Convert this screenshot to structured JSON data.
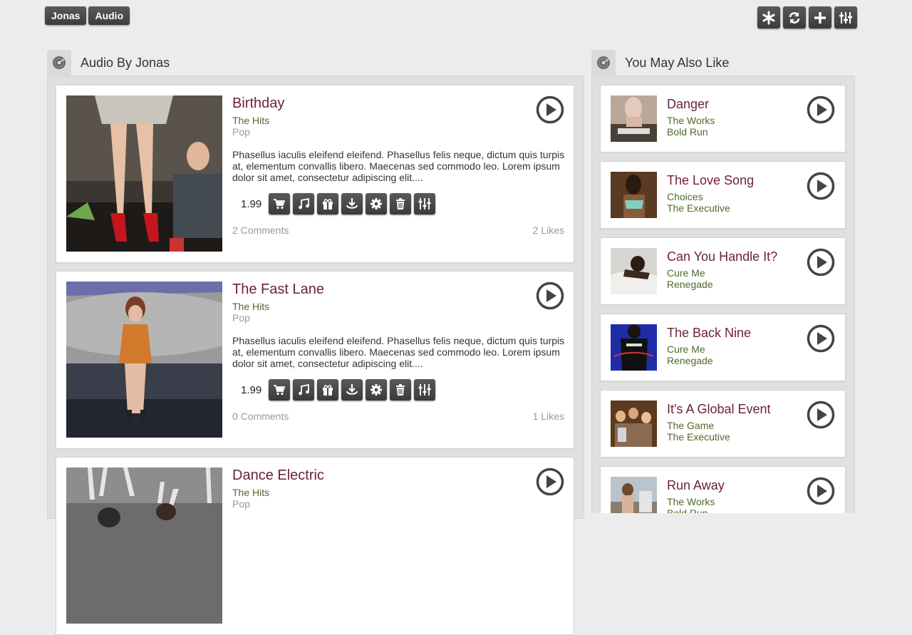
{
  "breadcrumbs": [
    "Jonas",
    "Audio"
  ],
  "toolbar_icons": [
    "asterisk-icon",
    "refresh-icon",
    "plus-icon",
    "sliders-icon"
  ],
  "main_panel": {
    "title": "Audio By Jonas",
    "tracks": [
      {
        "title": "Birthday",
        "album": "The Hits",
        "genre": "Pop",
        "description": "Phasellus iaculis eleifend eleifend. Phasellus felis neque, dictum quis turpis at, elementum convallis libero. Maecenas sed commodo leo. Lorem ipsum dolor sit amet, consectetur adipiscing elit....",
        "price": "1.99",
        "comments": "2 Comments",
        "likes": "2 Likes"
      },
      {
        "title": "The Fast Lane",
        "album": "The Hits",
        "genre": "Pop",
        "description": "Phasellus iaculis eleifend eleifend. Phasellus felis neque, dictum quis turpis at, elementum convallis libero. Maecenas sed commodo leo. Lorem ipsum dolor sit amet, consectetur adipiscing elit....",
        "price": "1.99",
        "comments": "0 Comments",
        "likes": "1 Likes"
      },
      {
        "title": "Dance Electric",
        "album": "The Hits",
        "genre": "Pop"
      }
    ],
    "action_icons": [
      "cart-icon",
      "music-note-icon",
      "gift-icon",
      "download-icon",
      "gear-icon",
      "trash-icon",
      "sliders-icon"
    ]
  },
  "side_panel": {
    "title": "You May Also Like",
    "tracks": [
      {
        "title": "Danger",
        "album": "The Works",
        "artist": "Bold Run"
      },
      {
        "title": "The Love Song",
        "album": "Choices",
        "artist": "The Executive"
      },
      {
        "title": "Can You Handle It?",
        "album": "Cure Me",
        "artist": "Renegade"
      },
      {
        "title": "The Back Nine",
        "album": "Cure Me",
        "artist": "Renegade"
      },
      {
        "title": "It's A Global Event",
        "album": "The Game",
        "artist": "The Executive"
      },
      {
        "title": "Run Away",
        "album": "The Works",
        "artist": "Bold Run"
      }
    ]
  },
  "colors": {
    "page_background": "#ececec",
    "title": "#6b1f3c",
    "subtitle": "#4f6a2a",
    "muted": "#999999",
    "button": "#444444"
  }
}
